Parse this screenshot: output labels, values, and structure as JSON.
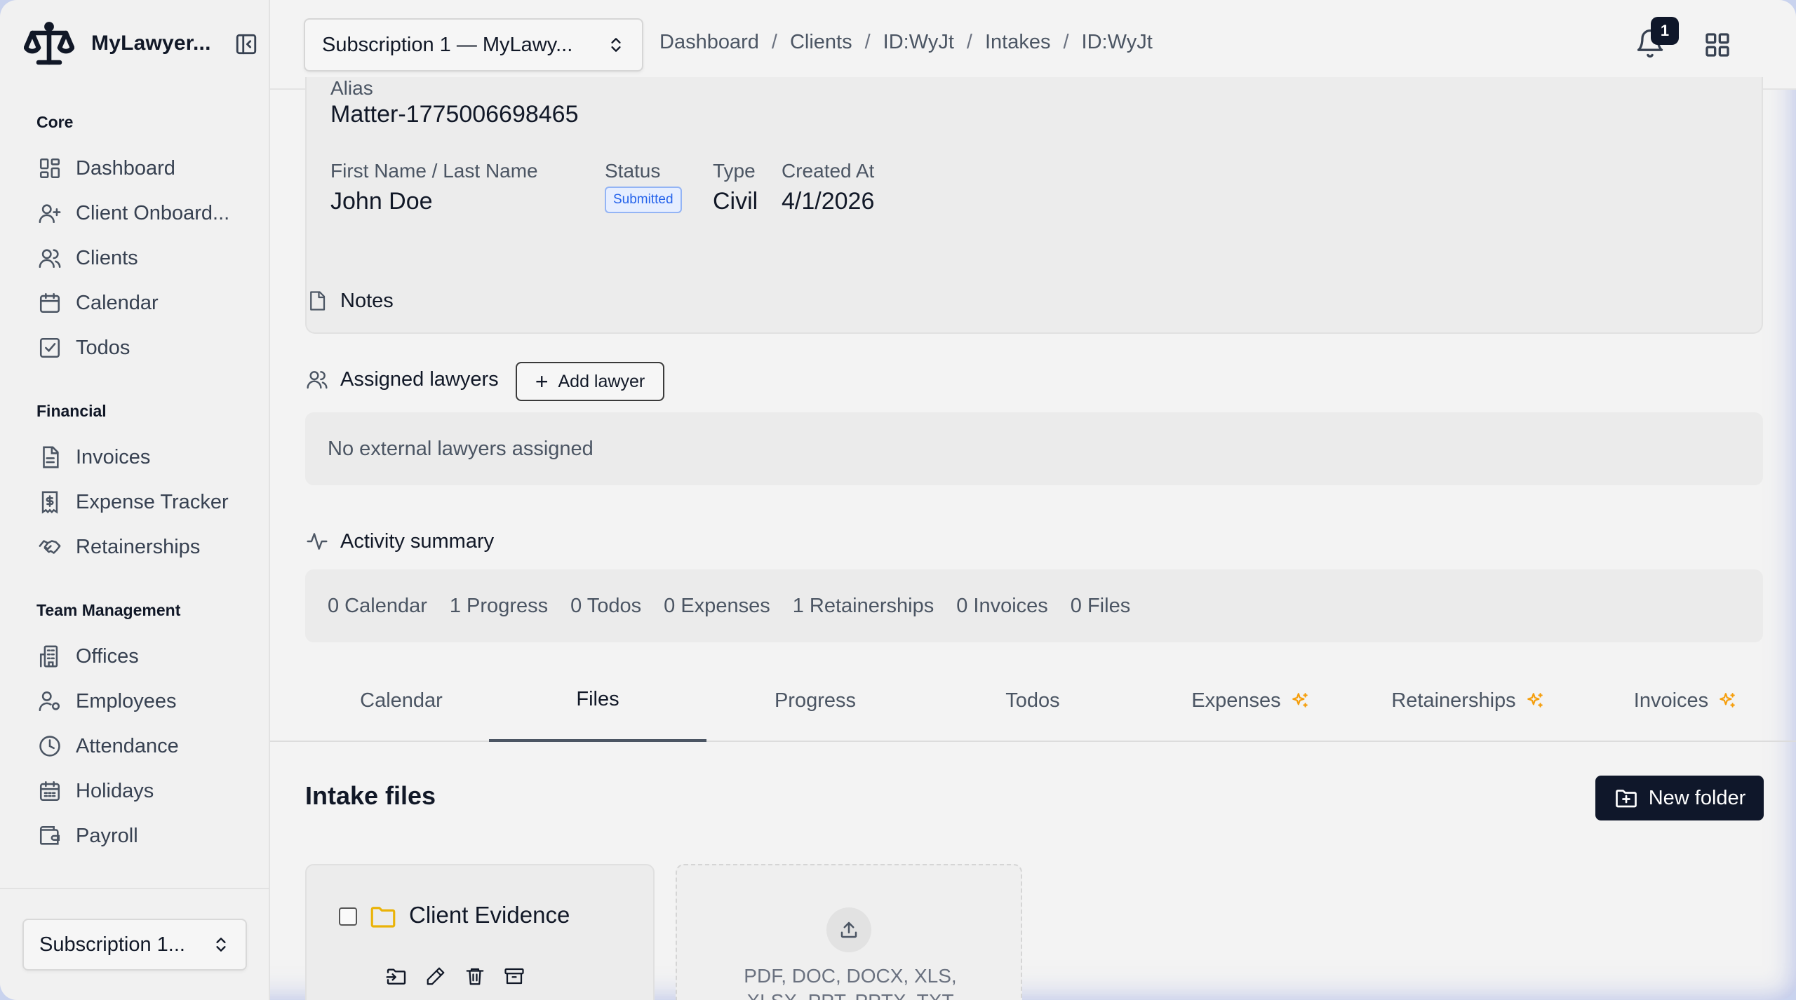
{
  "app": {
    "name": "MyLawyer..."
  },
  "sidebar": {
    "sections": [
      {
        "title": "Core",
        "items": [
          {
            "label": "Dashboard",
            "icon": "dashboard-icon"
          },
          {
            "label": "Client Onboard...",
            "icon": "user-plus-icon"
          },
          {
            "label": "Clients",
            "icon": "users-icon"
          },
          {
            "label": "Calendar",
            "icon": "calendar-icon"
          },
          {
            "label": "Todos",
            "icon": "checkbox-icon"
          }
        ]
      },
      {
        "title": "Financial",
        "items": [
          {
            "label": "Invoices",
            "icon": "document-icon"
          },
          {
            "label": "Expense Tracker",
            "icon": "receipt-dollar-icon"
          },
          {
            "label": "Retainerships",
            "icon": "handshake-icon"
          }
        ]
      },
      {
        "title": "Team Management",
        "items": [
          {
            "label": "Offices",
            "icon": "building-icon"
          },
          {
            "label": "Employees",
            "icon": "user-gear-icon"
          },
          {
            "label": "Attendance",
            "icon": "clock-icon"
          },
          {
            "label": "Holidays",
            "icon": "calendar-grid-icon"
          },
          {
            "label": "Payroll",
            "icon": "wallet-icon"
          }
        ]
      }
    ],
    "subscription_select": "Subscription 1..."
  },
  "topbar": {
    "subscription_select": "Subscription 1 — MyLawy...",
    "breadcrumb": [
      "Dashboard",
      "Clients",
      "ID:WyJt",
      "Intakes",
      "ID:WyJt"
    ],
    "notification_count": "1"
  },
  "intake": {
    "alias_label": "Alias",
    "alias_value": "Matter-1775006698465",
    "name_label": "First Name / Last Name",
    "name_value": "John Doe",
    "status_label": "Status",
    "status_value": "Submitted",
    "type_label": "Type",
    "type_value": "Civil",
    "created_label": "Created At",
    "created_value": "4/1/2026"
  },
  "notes": {
    "title": "Notes"
  },
  "lawyers": {
    "title": "Assigned lawyers",
    "add_label": "Add lawyer",
    "empty": "No external lawyers assigned"
  },
  "activity": {
    "title": "Activity summary",
    "items": [
      "0 Calendar",
      "1 Progress",
      "0 Todos",
      "0 Expenses",
      "1 Retainerships",
      "0 Invoices",
      "0 Files"
    ]
  },
  "tabs": [
    {
      "label": "Calendar"
    },
    {
      "label": "Files"
    },
    {
      "label": "Progress"
    },
    {
      "label": "Todos"
    },
    {
      "label": "Expenses"
    },
    {
      "label": "Retainerships"
    },
    {
      "label": "Invoices"
    }
  ],
  "files": {
    "title": "Intake files",
    "new_folder_label": "New folder",
    "folder_name": "Client Evidence",
    "upload_hint_line1": "PDF, DOC, DOCX, XLS,",
    "upload_hint_line2": "XLSX, PPT, PPTX, TXT"
  },
  "colors": {
    "accent_dark": "#0f172a",
    "status_blue": "#2563eb",
    "spark_orange": "#f59e0b",
    "folder_yellow": "#eab308"
  }
}
